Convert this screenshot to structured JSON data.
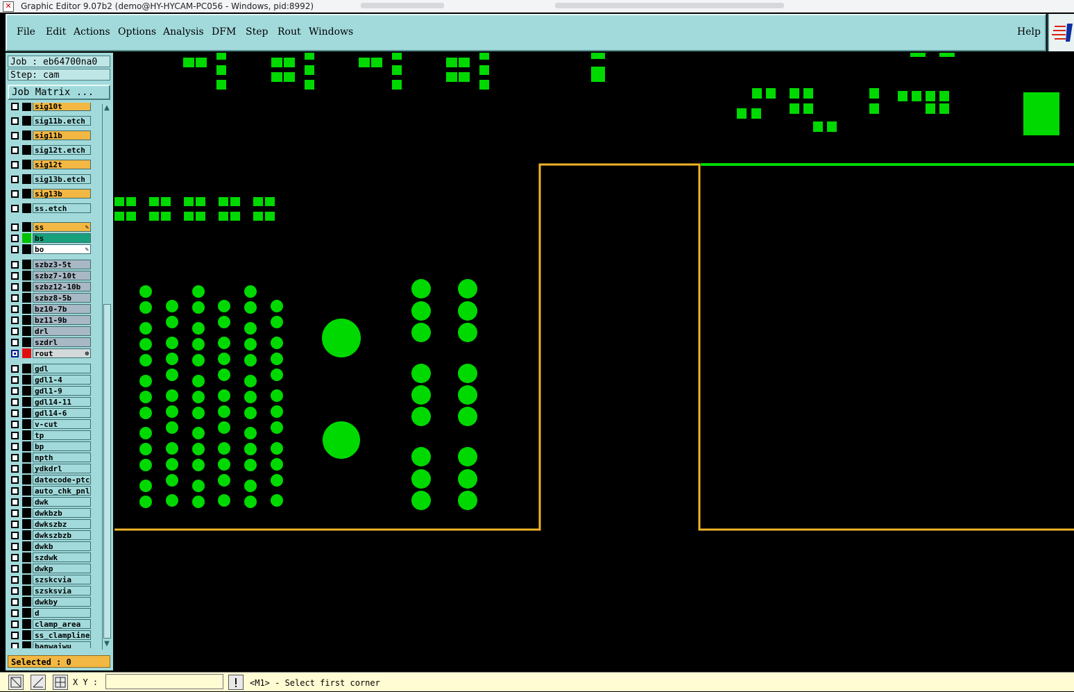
{
  "window": {
    "title": "Graphic Editor 9.07b2 (demo@HY-HYCAM-PC056 - Windows, pid:8992)"
  },
  "menu": {
    "items": [
      "File",
      "Edit",
      "Actions",
      "Options",
      "Analysis",
      "DFM",
      "Step",
      "Rout",
      "Windows"
    ],
    "help": "Help"
  },
  "job": {
    "job_line": "Job : eb64700na0",
    "step_line": "Step: cam",
    "matrix_button": "Job Matrix ..."
  },
  "layers": [
    {
      "name": "sig10t",
      "kind": "board"
    },
    {
      "name": "sig11b.etch",
      "kind": "etch"
    },
    {
      "name": "sig11b",
      "kind": "board"
    },
    {
      "name": "sig12t.etch",
      "kind": "etch"
    },
    {
      "name": "sig12t",
      "kind": "board"
    },
    {
      "name": "sig13b.etch",
      "kind": "etch"
    },
    {
      "name": "sig13b",
      "kind": "board"
    },
    {
      "name": "ss.etch",
      "kind": "etch"
    },
    {
      "name": "ss",
      "kind": "board",
      "mark": "✎"
    },
    {
      "name": "bs",
      "kind": "teal",
      "swatch": "#00c000"
    },
    {
      "name": "bo",
      "kind": "white",
      "mark": "✎"
    },
    {
      "name": "szbz3-5t",
      "kind": "drill"
    },
    {
      "name": "szbz7-10t",
      "kind": "drill"
    },
    {
      "name": "szbz12-10b",
      "kind": "drill"
    },
    {
      "name": "szbz8-5b",
      "kind": "drill"
    },
    {
      "name": "bz10-7b",
      "kind": "drill"
    },
    {
      "name": "bz11-9b",
      "kind": "drill"
    },
    {
      "name": "drl",
      "kind": "drill"
    },
    {
      "name": "szdrl",
      "kind": "drill"
    },
    {
      "name": "rout",
      "kind": "rout",
      "checked": true,
      "swatch": "#e01010",
      "mark": "⊕"
    },
    {
      "name": "gdl",
      "kind": "misc"
    },
    {
      "name": "gdl1-4",
      "kind": "misc"
    },
    {
      "name": "gdl1-9",
      "kind": "misc"
    },
    {
      "name": "gdl14-11",
      "kind": "misc"
    },
    {
      "name": "gdl14-6",
      "kind": "misc"
    },
    {
      "name": "v-cut",
      "kind": "misc"
    },
    {
      "name": "tp",
      "kind": "misc"
    },
    {
      "name": "bp",
      "kind": "misc"
    },
    {
      "name": "npth",
      "kind": "misc"
    },
    {
      "name": "ydkdrl",
      "kind": "misc"
    },
    {
      "name": "datecode-ptc",
      "kind": "misc"
    },
    {
      "name": "auto_chk_pnl",
      "kind": "misc"
    },
    {
      "name": "dwk",
      "kind": "misc"
    },
    {
      "name": "dwkbzb",
      "kind": "misc"
    },
    {
      "name": "dwkszbz",
      "kind": "misc"
    },
    {
      "name": "dwkszbzb",
      "kind": "misc"
    },
    {
      "name": "dwkb",
      "kind": "misc"
    },
    {
      "name": "szdwk",
      "kind": "misc"
    },
    {
      "name": "dwkp",
      "kind": "misc"
    },
    {
      "name": "szskcvia",
      "kind": "misc"
    },
    {
      "name": "szsksvia",
      "kind": "misc"
    },
    {
      "name": "dwkby",
      "kind": "misc"
    },
    {
      "name": "d",
      "kind": "misc"
    },
    {
      "name": "clamp_area",
      "kind": "misc"
    },
    {
      "name": "ss_clampline",
      "kind": "misc"
    },
    {
      "name": "banwaiwu",
      "kind": "misc"
    }
  ],
  "selected": "Selected : 0",
  "status": {
    "xy_label": "X Y :",
    "xy_value": "",
    "message": "<M1> - Select first corner"
  },
  "colors": {
    "pad": "#00d900",
    "rout": "#f0b428",
    "background": "#000000",
    "panel": "#a2dadb"
  }
}
